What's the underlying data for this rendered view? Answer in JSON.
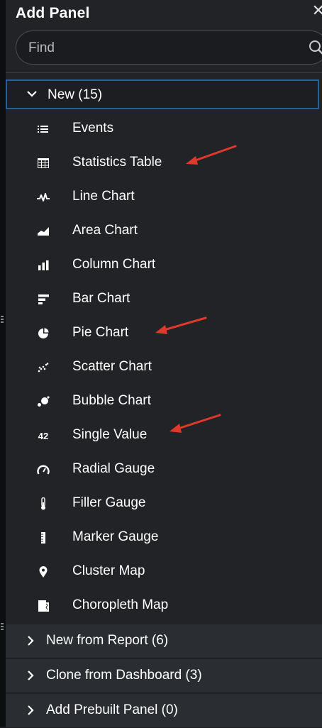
{
  "panel": {
    "title": "Add Panel"
  },
  "search": {
    "placeholder": "Find"
  },
  "groups": {
    "new": {
      "label": "New (15)"
    }
  },
  "items": [
    {
      "label": "Events",
      "icon": "list-icon"
    },
    {
      "label": "Statistics Table",
      "icon": "table-icon"
    },
    {
      "label": "Line Chart",
      "icon": "line-chart-icon"
    },
    {
      "label": "Area Chart",
      "icon": "area-chart-icon"
    },
    {
      "label": "Column Chart",
      "icon": "column-chart-icon"
    },
    {
      "label": "Bar Chart",
      "icon": "bar-chart-icon"
    },
    {
      "label": "Pie Chart",
      "icon": "pie-chart-icon"
    },
    {
      "label": "Scatter Chart",
      "icon": "scatter-chart-icon"
    },
    {
      "label": "Bubble Chart",
      "icon": "bubble-chart-icon"
    },
    {
      "label": "Single Value",
      "icon": "single-value-icon",
      "icon_text": "42"
    },
    {
      "label": "Radial Gauge",
      "icon": "radial-gauge-icon"
    },
    {
      "label": "Filler Gauge",
      "icon": "filler-gauge-icon"
    },
    {
      "label": "Marker Gauge",
      "icon": "marker-gauge-icon"
    },
    {
      "label": "Cluster Map",
      "icon": "map-pin-icon"
    },
    {
      "label": "Choropleth Map",
      "icon": "choropleth-map-icon"
    }
  ],
  "sections": [
    {
      "label": "New from Report (6)"
    },
    {
      "label": "Clone from Dashboard (3)"
    },
    {
      "label": "Add Prebuilt Panel (0)"
    }
  ],
  "colors": {
    "accent_border": "#2e5c99",
    "annotation_arrow": "#e0392b",
    "panel_bg": "#212327"
  }
}
